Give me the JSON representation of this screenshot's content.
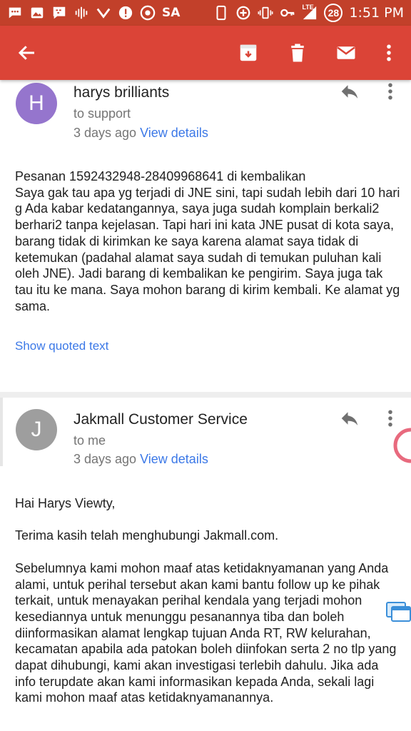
{
  "status_bar": {
    "carrier_text": "SA",
    "network_label": "LTE",
    "notification_count": "28",
    "time": "1:51 PM",
    "icons": [
      "chat-icon",
      "gallery-icon",
      "bbm-icon",
      "voice-icon",
      "vee-icon",
      "alert-icon",
      "chrome-icon",
      "phone-icon",
      "data-saver-icon",
      "vibrate-icon",
      "key-icon",
      "signal-icon"
    ]
  },
  "toolbar": {
    "icons": [
      "back-arrow-icon",
      "archive-icon",
      "delete-icon",
      "mail-icon",
      "more-vert-icon"
    ],
    "background": "#db4437"
  },
  "messages": [
    {
      "avatar_letter": "H",
      "avatar_color": "#9575cd",
      "sender": "harys brilliants",
      "recipient": "to support",
      "date": "3 days ago",
      "details_link": "View details",
      "body": "Pesanan 1592432948-28409968641 di kembalikan\nSaya gak tau apa yg terjadi di JNE sini, tapi sudah lebih dari 10 hari g Ada kabar kedatangannya, saya juga sudah komplain berkali2 berhari2 tanpa kejelasan. Tapi hari ini kata JNE pusat di kota saya, barang tidak di kirimkan ke saya karena alamat saya tidak di ketemukan (padahal alamat saya sudah di temukan puluhan kali oleh JNE). Jadi barang di kembalikan ke pengirim. Saya juga tak tau itu ke mana. Saya mohon barang di kirim kembali. Ke alamat yg sama.",
      "quoted_link": "Show quoted text"
    },
    {
      "avatar_letter": "J",
      "avatar_color": "#9e9e9e",
      "sender": "Jakmall Customer Service",
      "recipient": "to me",
      "date": "3 days ago",
      "details_link": "View details",
      "body": "Hai Harys Viewty,\n\nTerima kasih telah menghubungi Jakmall.com.\n\nSebelumnya kami mohon maaf atas ketidaknyamanan yang Anda alami, untuk perihal tersebut akan kami bantu follow up ke pihak terkait, untuk menayakan perihal kendala yang terjadi mohon kesediannya untuk menunggu pesanannya tiba dan boleh diinformasikan alamat lengkap tujuan Anda RT, RW kelurahan, kecamatan apabila ada patokan boleh diinfokan serta 2 no tlp yang dapat dihubungi, kami akan investigasi terlebih dahulu. Jika ada info terupdate akan kami informasikan kepada Anda, sekali lagi kami mohon maaf atas ketidaknyamanannya."
    }
  ]
}
